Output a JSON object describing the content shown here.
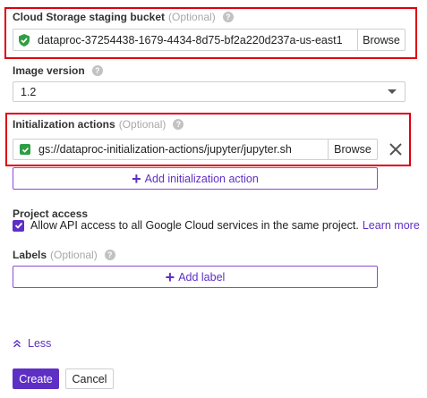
{
  "staging_bucket": {
    "label": "Cloud Storage staging bucket",
    "optional": "(Optional)",
    "value": "dataproc-37254438-1679-4434-8d75-bf2a220d237a-us-east1",
    "browse_label": "Browse"
  },
  "image_version": {
    "label": "Image version",
    "value": "1.2"
  },
  "init_actions": {
    "label": "Initialization actions",
    "optional": "(Optional)",
    "value": "gs://dataproc-initialization-actions/jupyter/jupyter.sh",
    "browse_label": "Browse",
    "add_label": "Add initialization action"
  },
  "project_access": {
    "label": "Project access",
    "checkbox_text": "Allow API access to all Google Cloud services in the same project.",
    "checked": true,
    "learn_more": "Learn more"
  },
  "labels": {
    "label": "Labels",
    "optional": "(Optional)",
    "add_label": "Add label"
  },
  "less_label": "Less",
  "actions": {
    "create": "Create",
    "cancel": "Cancel"
  },
  "colors": {
    "accent": "#5e2fc4",
    "highlight_border": "#e0000e",
    "success": "#2e9e44"
  }
}
